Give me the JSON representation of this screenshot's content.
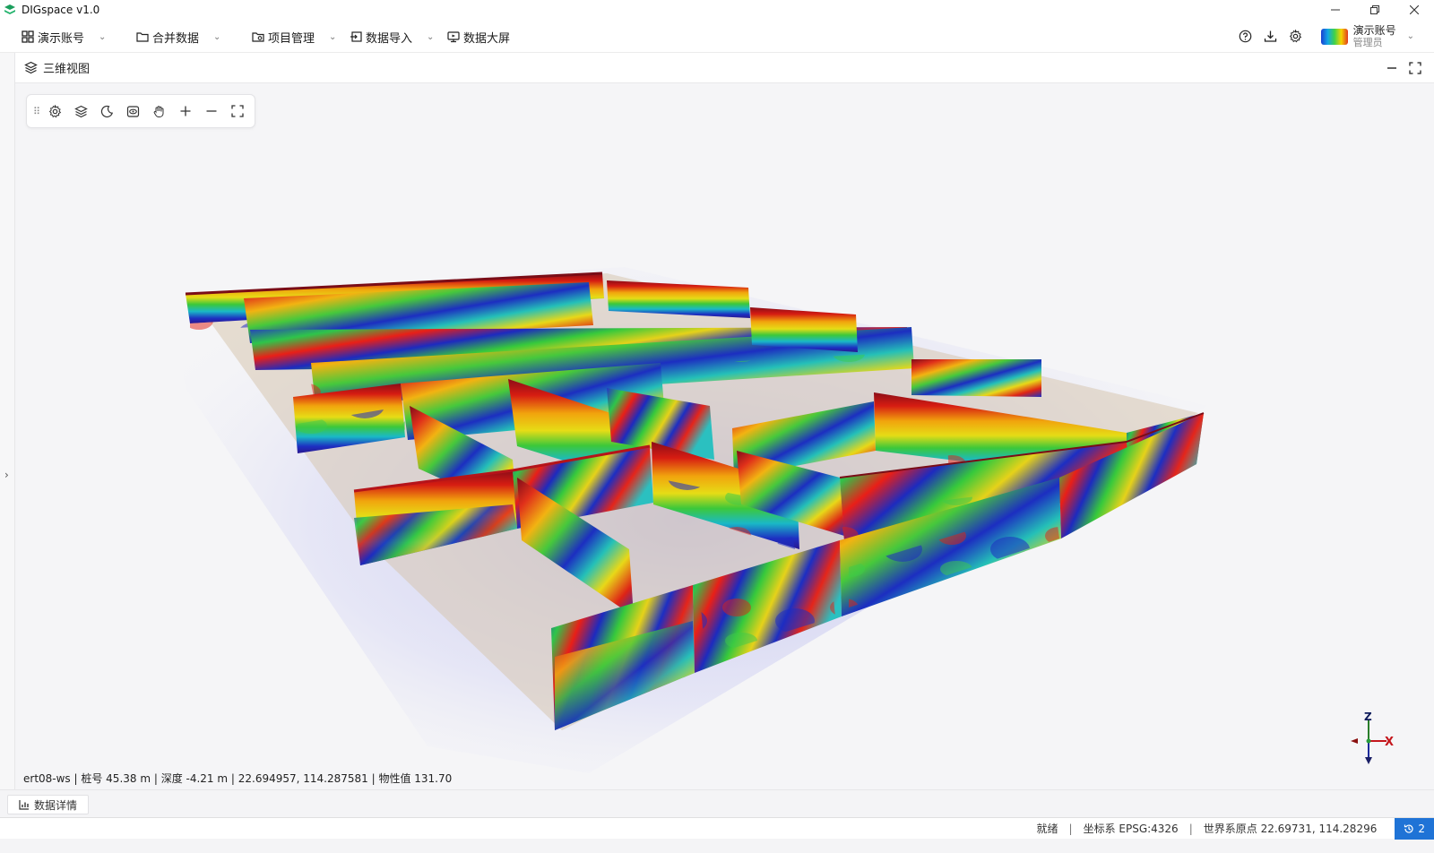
{
  "app": {
    "title": "DIGspace v1.0"
  },
  "menu": {
    "account": "演示账号",
    "merge": "合并数据",
    "project": "项目管理",
    "import": "数据导入",
    "dashboard": "数据大屏"
  },
  "user": {
    "name": "演示账号",
    "role": "管理员"
  },
  "panel": {
    "title": "三维视图"
  },
  "viewport": {
    "info": "ert08-ws | 桩号 45.38 m | 深度 -4.21 m | 22.694957, 114.287581 | 物性值 131.70"
  },
  "axes": {
    "z": "Z",
    "x": "X"
  },
  "details": {
    "tab_label": "数据详情"
  },
  "status": {
    "ready": "就绪",
    "crs": "坐标系 EPSG:4326",
    "origin": "世界系原点  22.69731, 114.28296",
    "badge_count": "2"
  },
  "colors": {
    "accent": "#1f73d6",
    "logo": "#1a9e5c"
  }
}
